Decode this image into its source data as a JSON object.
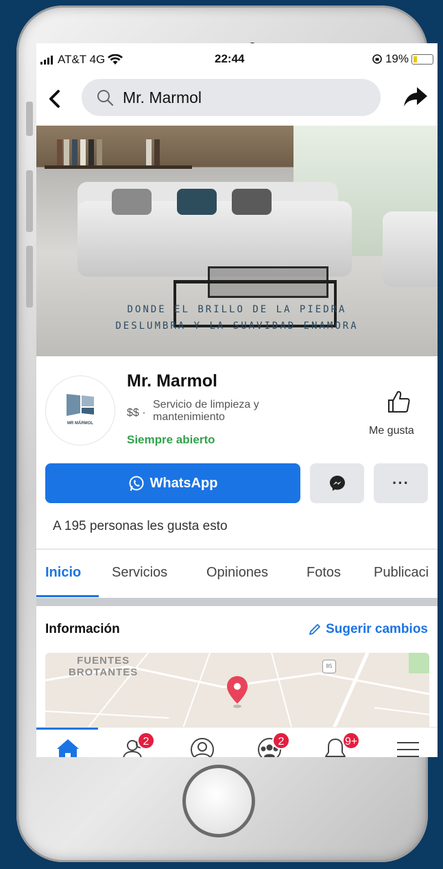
{
  "status_bar": {
    "carrier": "AT&T 4G",
    "time": "22:44",
    "battery": "19%"
  },
  "search": {
    "query": "Mr. Marmol"
  },
  "cover": {
    "tagline_line1": "DONDE EL BRILLO DE LA PIEDRA",
    "tagline_line2": "DESLUMBRA Y LA SUAVIDAD ENAMORA"
  },
  "page": {
    "name": "Mr. Marmol",
    "price": "$$ ·",
    "category": "Servicio de limpieza y mantenimiento",
    "hours": "Siempre abierto",
    "logo_text": "MR MÁRMOL",
    "like_label": "Me gusta"
  },
  "actions": {
    "whatsapp_label": "WhatsApp",
    "more_label": "···"
  },
  "likes_text": "A 195 personas les gusta esto",
  "tabs": [
    {
      "label": "Inicio",
      "active": true
    },
    {
      "label": "Servicios",
      "active": false
    },
    {
      "label": "Opiniones",
      "active": false
    },
    {
      "label": "Fotos",
      "active": false
    },
    {
      "label": "Publicaci",
      "active": false
    }
  ],
  "info": {
    "title": "Información",
    "suggest_label": "Sugerir cambios",
    "map_label_line1": "FUENTES",
    "map_label_line2": "BROTANTES",
    "road_shield": "85"
  },
  "bottom_nav": {
    "friends_badge": "2",
    "groups_badge": "2",
    "notifications_badge": "9+"
  },
  "colors": {
    "accent": "#1b74e4",
    "open_green": "#31a24c",
    "badge_red": "#e41e3f",
    "pin_red": "#e8435a"
  }
}
